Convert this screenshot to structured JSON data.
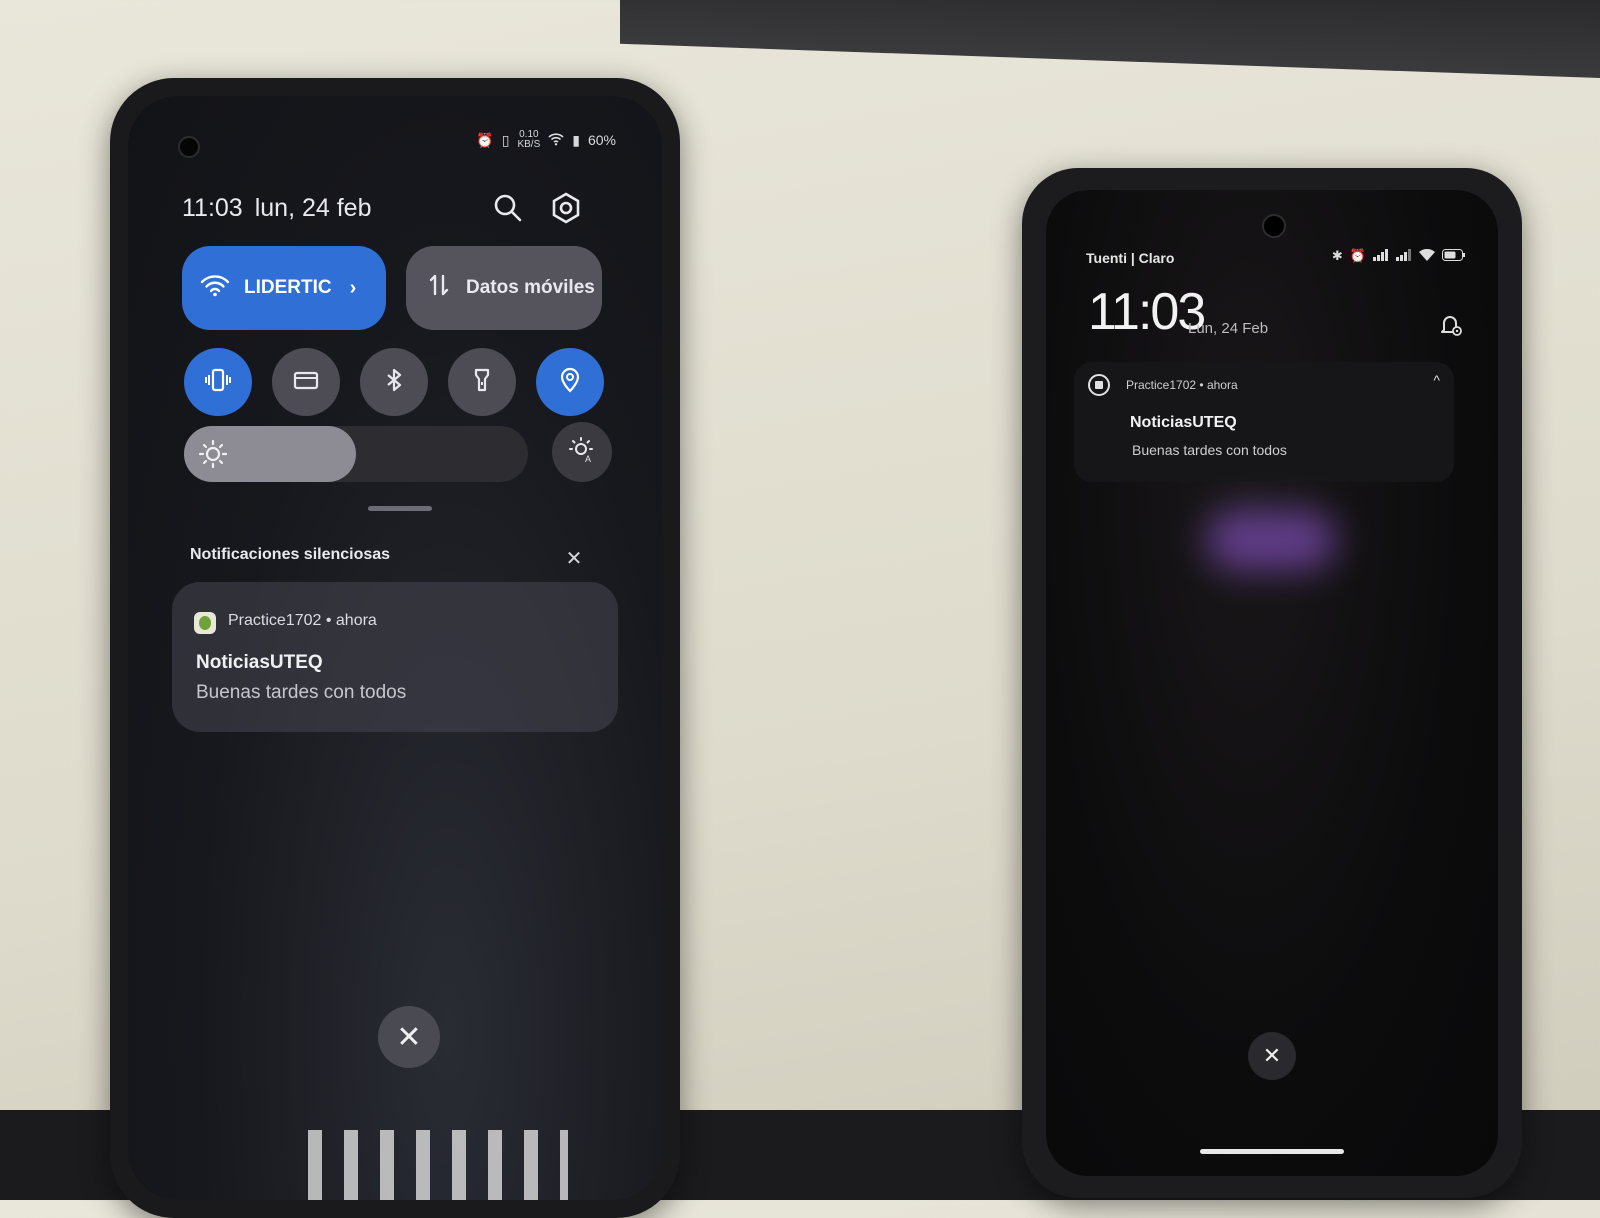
{
  "phone_left": {
    "status_bar": {
      "speed": "0.10",
      "speed_unit": "KB/S",
      "battery": "60%"
    },
    "header": {
      "time": "11:03",
      "date": "lun, 24 feb"
    },
    "tiles": {
      "wifi_label": "LIDERTIC",
      "data_label": "Datos móviles"
    },
    "toggles": [
      {
        "icon": "vibrate-icon",
        "on": true
      },
      {
        "icon": "card-icon",
        "on": false
      },
      {
        "icon": "bluetooth-icon",
        "on": false
      },
      {
        "icon": "flashlight-icon",
        "on": false
      },
      {
        "icon": "location-icon",
        "on": true
      }
    ],
    "brightness": {
      "level": 0.5
    },
    "silent_section": {
      "title": "Notificaciones silenciosas",
      "close_symbol": "✕"
    },
    "notification": {
      "app": "Practice1702",
      "time": "ahora",
      "title": "NoticiasUTEQ",
      "body": "Buenas tardes con todos"
    },
    "clear_button": "✕"
  },
  "phone_right": {
    "status_bar": {
      "carrier": "Tuenti | Claro"
    },
    "lock": {
      "time": "11:03",
      "date": "Lun, 24 Feb"
    },
    "notification": {
      "app": "Practice1702",
      "time": "ahora",
      "title": "NoticiasUTEQ",
      "body": "Buenas tardes con todos",
      "expand_symbol": "^"
    },
    "clear_button": "✕"
  },
  "colors": {
    "accent": "#2f6fd6",
    "tile_inactive": "#4d4c54",
    "glow": "#7a4bb0"
  }
}
